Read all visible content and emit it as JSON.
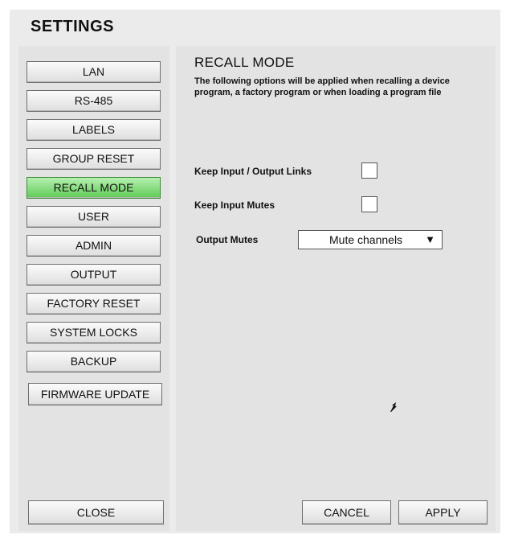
{
  "window": {
    "title": "SETTINGS"
  },
  "sidebar": {
    "items": [
      {
        "label": "LAN"
      },
      {
        "label": "RS-485"
      },
      {
        "label": "LABELS"
      },
      {
        "label": "GROUP RESET"
      },
      {
        "label": "RECALL MODE",
        "active": true
      },
      {
        "label": "USER"
      },
      {
        "label": "ADMIN"
      },
      {
        "label": "OUTPUT"
      },
      {
        "label": "FACTORY RESET"
      },
      {
        "label": "SYSTEM LOCKS"
      },
      {
        "label": "BACKUP"
      },
      {
        "label": "FIRMWARE UPDATE"
      }
    ],
    "close_label": "CLOSE"
  },
  "main": {
    "heading": "RECALL MODE",
    "description": "The following options will be applied when recalling a device program, a factory program or when loading a program file",
    "options": {
      "keep_links_label": "Keep Input / Output Links",
      "keep_links_checked": false,
      "keep_mutes_label": "Keep Input Mutes",
      "keep_mutes_checked": false,
      "output_mutes_label": "Output Mutes",
      "output_mutes_value": "Mute channels"
    },
    "cancel_label": "CANCEL",
    "apply_label": "APPLY"
  },
  "colors": {
    "active_button": "#5fcb55",
    "panel_bg": "#e3e3e3",
    "frame_bg": "#ebebeb"
  },
  "icons": {
    "dropdown": "triangle-down-icon",
    "cursor": "mouse-pointer-icon"
  }
}
